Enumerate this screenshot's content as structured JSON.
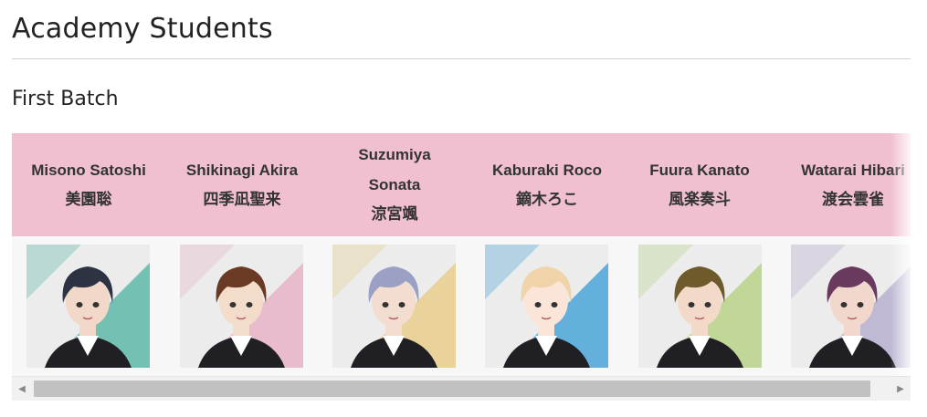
{
  "page": {
    "title": "Academy Students",
    "section_title": "First Batch"
  },
  "students": [
    {
      "name": "Misono Satoshi",
      "name_jp": "美園聡",
      "bg": "#5fb8a8",
      "hair": "#2d3343",
      "skin": "#f2d8c8"
    },
    {
      "name": "Shikinagi Akira",
      "name_jp": "四季凪聖来",
      "bg": "#e8b4c8",
      "hair": "#6a3a24",
      "skin": "#f4dccb"
    },
    {
      "name": "Suzumiya Sonata",
      "name_jp": "涼宮颯",
      "bg": "#e9cf8c",
      "hair": "#9aa1c4",
      "skin": "#f3ddd0"
    },
    {
      "name": "Kaburaki Roco",
      "name_jp": "鏑木ろこ",
      "bg": "#4aa6d8",
      "hair": "#f0d3a8",
      "skin": "#fbe4d8"
    },
    {
      "name": "Fuura Kanato",
      "name_jp": "風楽奏斗",
      "bg": "#b8d48a",
      "hair": "#6e5a2a",
      "skin": "#f3dac8"
    },
    {
      "name": "Watarai Hibari",
      "name_jp": "渡会雲雀",
      "bg": "#b7b0cf",
      "hair": "#6a3a5e",
      "skin": "#f2d8cc"
    }
  ],
  "colors": {
    "header_row": "#f0c0d0",
    "image_row": "#f7f7f7",
    "scroll_thumb": "#c1c1c1"
  },
  "scrollbar": {
    "left_arrow_icon": "triangle-left-icon",
    "right_arrow_icon": "triangle-right-icon"
  }
}
